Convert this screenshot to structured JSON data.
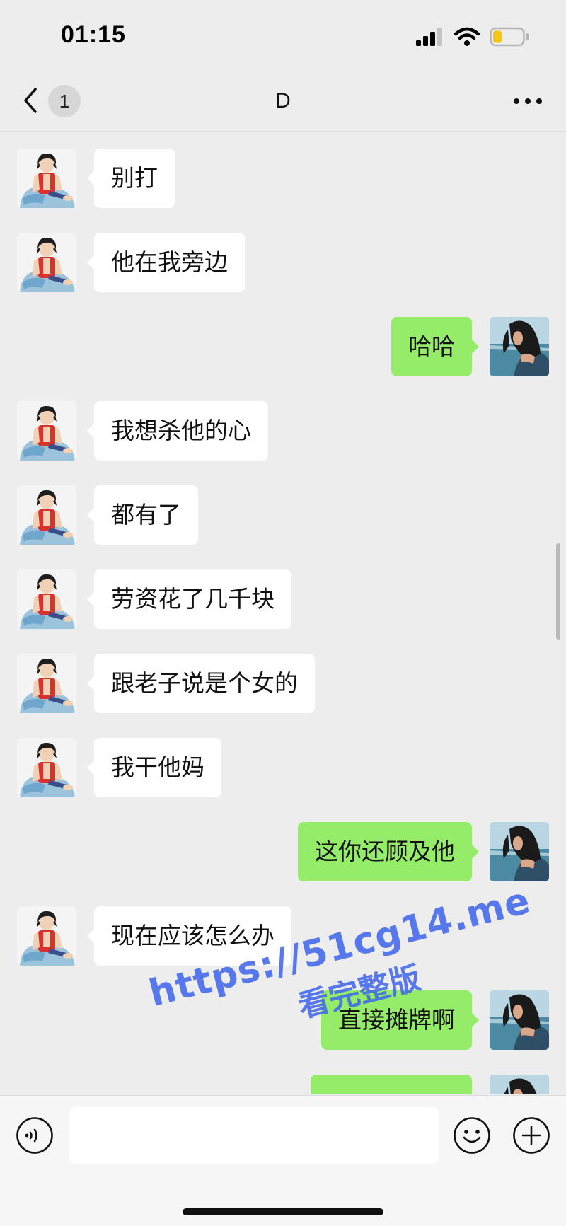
{
  "status_bar": {
    "time": "01:15",
    "icons": [
      "signal-icon",
      "wifi-icon",
      "battery-icon"
    ]
  },
  "nav": {
    "back_icon": "chevron-left-icon",
    "unread_count": "1",
    "title": "D",
    "more_icon": "ellipsis-icon"
  },
  "messages": [
    {
      "side": "in",
      "text": "别打"
    },
    {
      "side": "in",
      "text": "他在我旁边"
    },
    {
      "side": "out",
      "text": "哈哈"
    },
    {
      "side": "in",
      "text": "我想杀他的心"
    },
    {
      "side": "in",
      "text": "都有了"
    },
    {
      "side": "in",
      "text": "劳资花了几千块"
    },
    {
      "side": "in",
      "text": "跟老子说是个女的"
    },
    {
      "side": "in",
      "text": "我干他妈"
    },
    {
      "side": "out",
      "text": "这你还顾及他"
    },
    {
      "side": "in",
      "text": "现在应该怎么办"
    },
    {
      "side": "out",
      "text": "直接摊牌啊"
    },
    {
      "side": "out",
      "text": ""
    }
  ],
  "watermark": {
    "url": "https://51cg14.me",
    "subtitle": "看完整版"
  },
  "input_bar": {
    "voice_icon": "voice-icon",
    "input_value": "",
    "emoji_icon": "emoji-icon",
    "plus_icon": "plus-icon"
  },
  "colors": {
    "background": "#ededed",
    "incoming_bubble": "#ffffff",
    "outgoing_bubble": "#95ec69",
    "watermark": "#4268ec"
  }
}
